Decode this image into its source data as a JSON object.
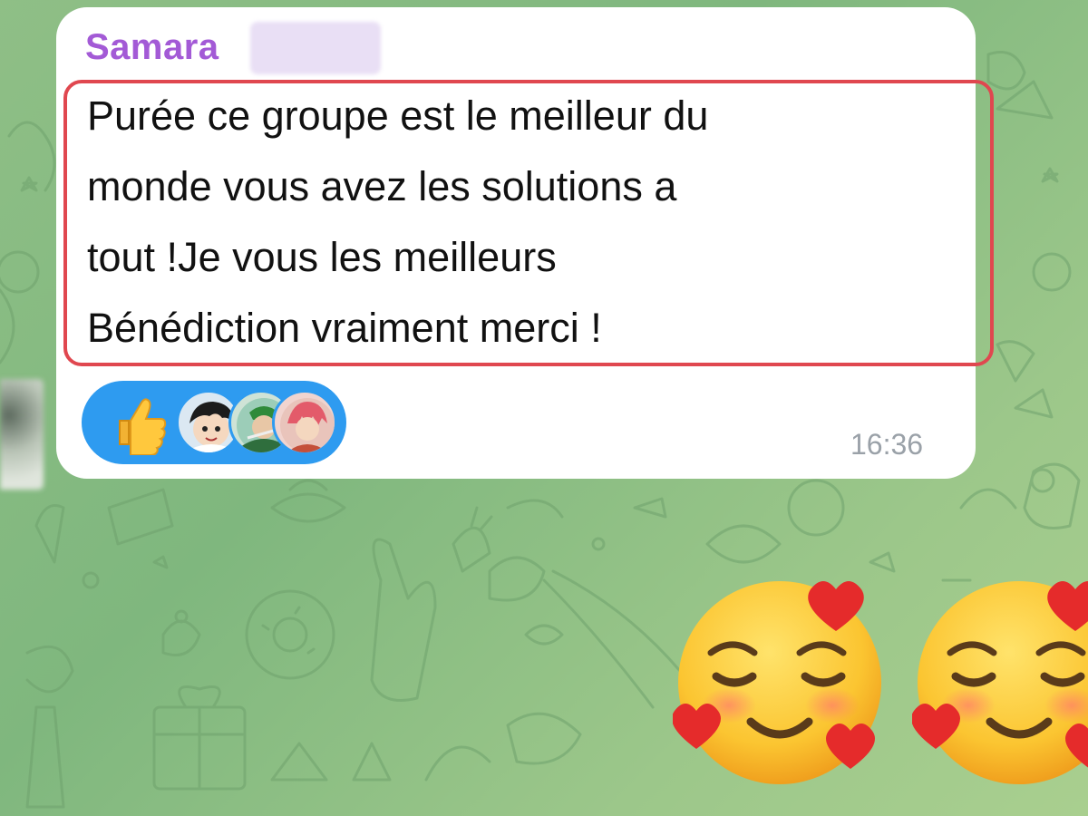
{
  "message": {
    "sender_name": "Samara",
    "text_lines": [
      "Purée ce groupe est le meilleur du",
      "monde vous avez les solutions a",
      "tout !Je vous les meilleurs",
      "Bénédiction vraiment merci !"
    ],
    "time": "16:36"
  },
  "reactions": {
    "emoji_icon": "thumbs-up-icon",
    "avatars": [
      "reactor-avatar-1",
      "reactor-avatar-2",
      "reactor-avatar-3"
    ],
    "background_color": "#2e9bf0"
  },
  "stickers": [
    "smiling-face-with-hearts-icon",
    "smiling-face-with-hearts-icon"
  ],
  "colors": {
    "sender_name": "#a35ad6",
    "highlight_border": "#e0474f",
    "timestamp": "#9aa1a8",
    "chat_background": "#8fbf86"
  }
}
